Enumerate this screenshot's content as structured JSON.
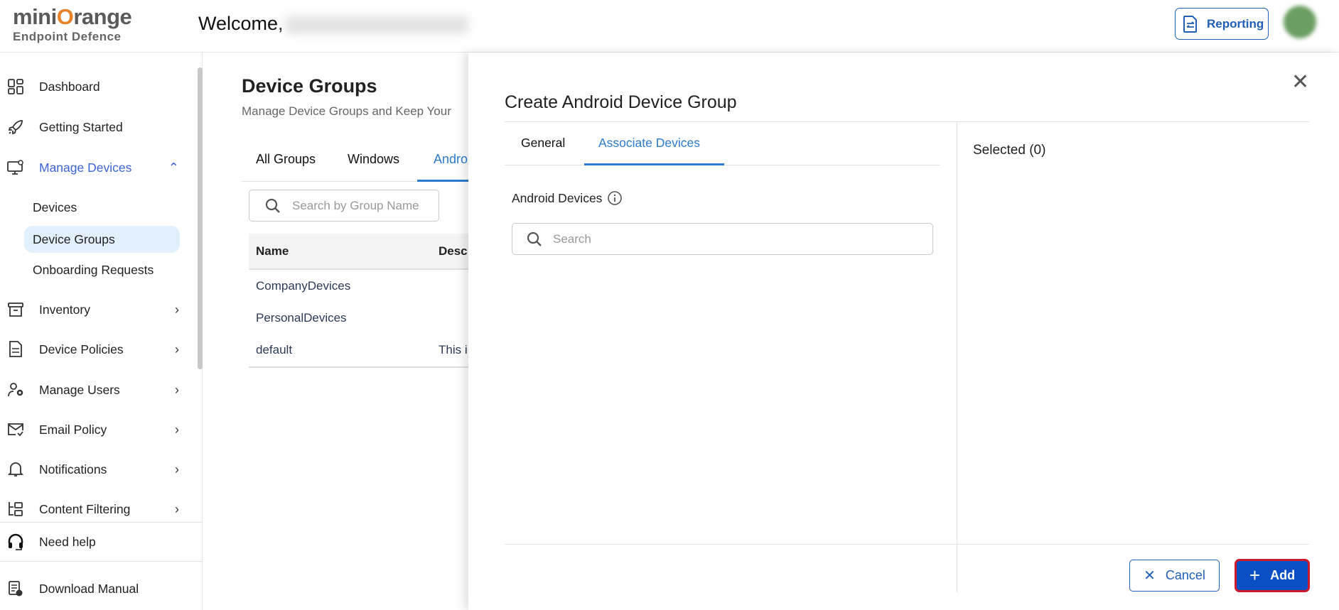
{
  "header": {
    "logo_text_a": "mini",
    "logo_text_o": "O",
    "logo_text_b": "range",
    "logo_sub": "Endpoint Defence",
    "welcome": "Welcome,",
    "reporting": "Reporting"
  },
  "sidebar": {
    "items": [
      {
        "label": "Dashboard"
      },
      {
        "label": "Getting Started"
      },
      {
        "label": "Manage Devices"
      },
      {
        "label": "Devices"
      },
      {
        "label": "Device Groups"
      },
      {
        "label": "Onboarding Requests"
      },
      {
        "label": "Inventory"
      },
      {
        "label": "Device Policies"
      },
      {
        "label": "Manage Users"
      },
      {
        "label": "Email Policy"
      },
      {
        "label": "Notifications"
      },
      {
        "label": "Content Filtering"
      }
    ],
    "need_help": "Need help",
    "download_manual": "Download Manual"
  },
  "main": {
    "title": "Device Groups",
    "subtitle": "Manage Device Groups and Keep Your",
    "tabs": [
      "All Groups",
      "Windows",
      "Andro"
    ],
    "search_placeholder": "Search by Group Name",
    "columns": [
      "Name",
      "Desc"
    ],
    "rows": [
      {
        "name": "CompanyDevices",
        "desc": ""
      },
      {
        "name": "PersonalDevices",
        "desc": ""
      },
      {
        "name": "default",
        "desc": "This i"
      }
    ]
  },
  "panel": {
    "title": "Create Android Device Group",
    "tabs": [
      "General",
      "Associate Devices"
    ],
    "devices_label": "Android Devices",
    "search_placeholder": "Search",
    "selected": "Selected (0)",
    "cancel": "Cancel",
    "add": "Add"
  },
  "colors": {
    "accent": "#1f5fb8",
    "active_tab": "#2b7bd0",
    "add_bg": "#0b4fc4",
    "add_outline": "#d0182b",
    "highlight": "#e1f0fc"
  }
}
